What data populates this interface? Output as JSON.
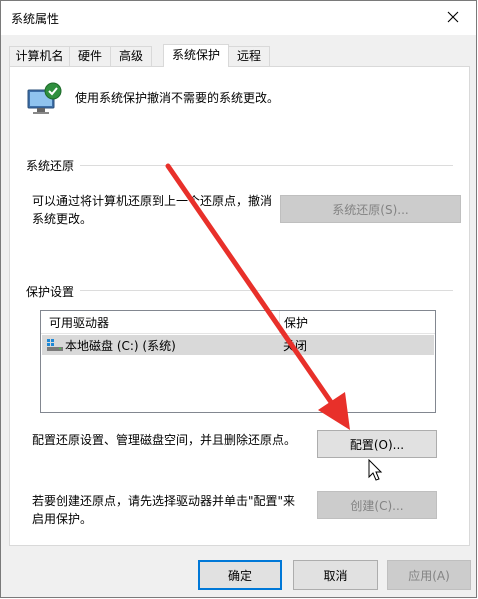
{
  "window": {
    "title": "系统属性"
  },
  "tabs": [
    {
      "label": "计算机名"
    },
    {
      "label": "硬件"
    },
    {
      "label": "高级"
    },
    {
      "label": "系统保护",
      "active": true
    },
    {
      "label": "远程"
    }
  ],
  "panel": {
    "description": "使用系统保护撤消不需要的系统更改。",
    "restore_group": {
      "title": "系统还原",
      "text_line1": "可以通过将计算机还原到上一个还原点，撤消",
      "text_line2": "系统更改。",
      "button": "系统还原(S)..."
    },
    "protection_group": {
      "title": "保护设置",
      "columns": [
        "可用驱动器",
        "保护"
      ],
      "rows": [
        {
          "drive": "本地磁盘 (C:) (系统)",
          "protection": "关闭"
        }
      ],
      "configure_text": "配置还原设置、管理磁盘空间，并且删除还原点。",
      "configure_button": "配置(O)...",
      "create_text_line1": "若要创建还原点，请先选择驱动器并单击\"配置\"来",
      "create_text_line2": "启用保护。",
      "create_button": "创建(C)..."
    }
  },
  "footer": {
    "ok": "确定",
    "cancel": "取消",
    "apply": "应用(A)"
  },
  "colors": {
    "annotation_arrow": "#e8302a",
    "focus_border": "#0078d7"
  }
}
